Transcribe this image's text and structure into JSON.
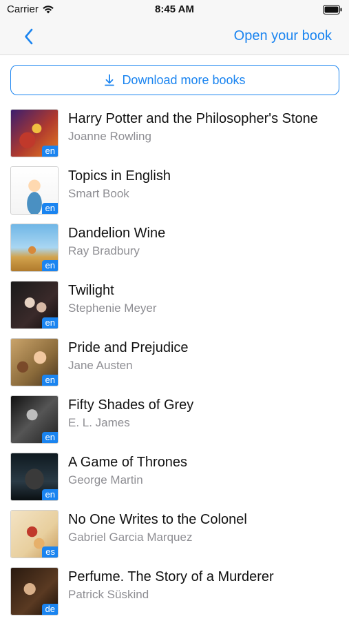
{
  "status_bar": {
    "carrier": "Carrier",
    "time": "8:45 AM"
  },
  "nav": {
    "open_book_label": "Open your book"
  },
  "download_button": {
    "label": "Download more books"
  },
  "colors": {
    "accent": "#1a84f0",
    "secondary_text": "#8e8e93"
  },
  "books": [
    {
      "title": "Harry Potter and the Philosopher's Stone",
      "author": "Joanne Rowling",
      "lang": "en"
    },
    {
      "title": "Topics in English",
      "author": "Smart Book",
      "lang": "en"
    },
    {
      "title": "Dandelion Wine",
      "author": "Ray Bradbury",
      "lang": "en"
    },
    {
      "title": "Twilight",
      "author": "Stephenie Meyer",
      "lang": "en"
    },
    {
      "title": "Pride and Prejudice",
      "author": "Jane Austen",
      "lang": "en"
    },
    {
      "title": "Fifty Shades of Grey",
      "author": "E. L. James",
      "lang": "en"
    },
    {
      "title": "A Game of Thrones",
      "author": "George Martin",
      "lang": "en"
    },
    {
      "title": "No One Writes to the Colonel",
      "author": "Gabriel Garcia Marquez",
      "lang": "es"
    },
    {
      "title": "Perfume. The Story of a Murderer",
      "author": "Patrick Süskind",
      "lang": "de"
    }
  ]
}
